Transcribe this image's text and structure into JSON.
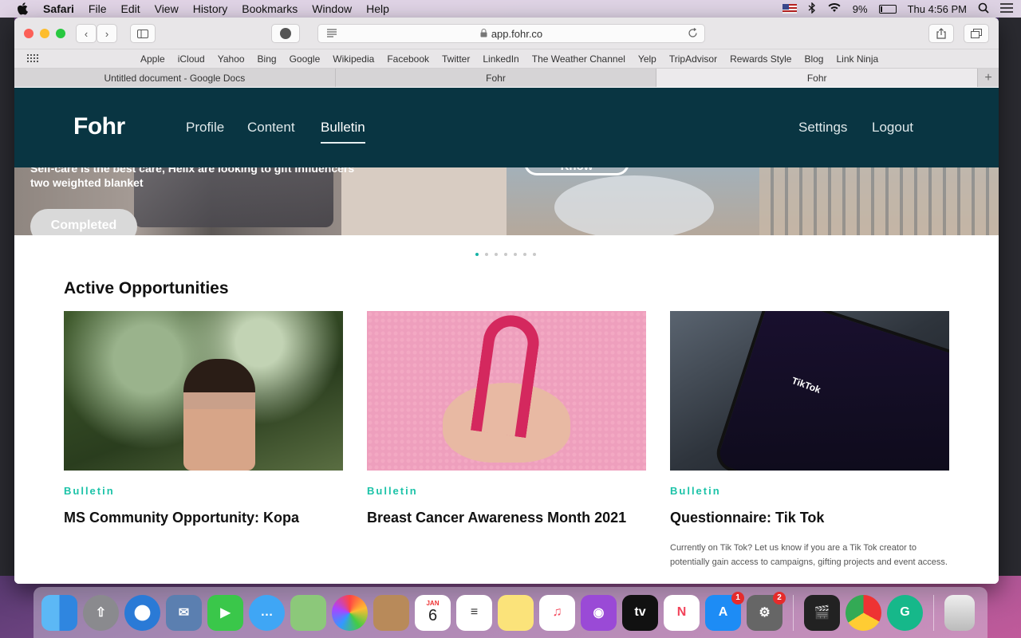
{
  "menubar": {
    "app": "Safari",
    "items": [
      "File",
      "Edit",
      "View",
      "History",
      "Bookmarks",
      "Window",
      "Help"
    ],
    "battery": "9%",
    "clock": "Thu 4:56 PM"
  },
  "browser": {
    "url": "app.fohr.co",
    "bookmarks": [
      "Apple",
      "iCloud",
      "Yahoo",
      "Bing",
      "Google",
      "Wikipedia",
      "Facebook",
      "Twitter",
      "LinkedIn",
      "The Weather Channel",
      "Yelp",
      "TripAdvisor",
      "Rewards Style",
      "Blog",
      "Link Ninja"
    ],
    "tabs": [
      "Untitled document - Google Docs",
      "Fohr",
      "Fohr"
    ],
    "active_tab": 2
  },
  "nav": {
    "logo": "Fohr",
    "links": [
      "Profile",
      "Content",
      "Bulletin"
    ],
    "active": "Bulletin",
    "right_links": [
      "Settings",
      "Logout"
    ]
  },
  "hero": {
    "text": "Self-care is the best care, Helix are looking to gift influencers two weighted blanket",
    "completed_label": "Completed",
    "know_label": "Know",
    "dots": 7,
    "active_dot": 0
  },
  "section": {
    "title": "Active Opportunities"
  },
  "cards": [
    {
      "category": "Bulletin",
      "title": "MS Community Opportunity: Kopa",
      "description": ""
    },
    {
      "category": "Bulletin",
      "title": "Breast Cancer Awareness Month 2021",
      "description": ""
    },
    {
      "category": "Bulletin",
      "title": "Questionnaire: Tik Tok",
      "description": "Currently on Tik Tok? Let us know if you are a Tik Tok creator to potentially gain access to campaigns, gifting projects and event access.",
      "image_text": "TikTok"
    }
  ],
  "dock": {
    "calendar_month": "JAN",
    "calendar_day": "6",
    "appstore_badge": "1",
    "settings_badge": "2"
  },
  "colors": {
    "nav_bg": "#093542",
    "accent": "#1cc3a8"
  }
}
